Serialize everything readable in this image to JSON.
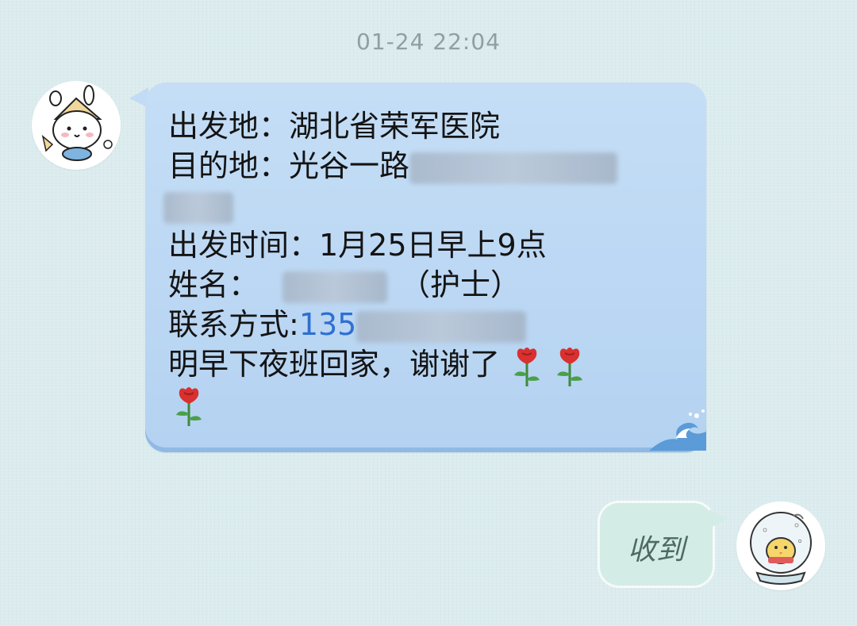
{
  "chat": {
    "timestamp": "01-24 22:04",
    "incoming": {
      "lines": {
        "l1": "出发地：湖北省荣军医院",
        "l2": "目的地：光谷一路",
        "l4": "出发时间：1月25日早上9点",
        "l5a": "姓名：",
        "l5b": "（护士）",
        "l6a": "联系方式:",
        "l6b": "135",
        "l7": "明早下夜班回家，谢谢了"
      },
      "emoji": "rose-icon",
      "redacted_fields": [
        "destination-detail",
        "name",
        "phone-rest"
      ]
    },
    "outgoing": {
      "text": "收到"
    },
    "colors": {
      "background": "#dcecee",
      "incoming_bubble": "#c5def6",
      "outgoing_bubble": "#d4ece6",
      "link": "#2f6fd1"
    }
  }
}
